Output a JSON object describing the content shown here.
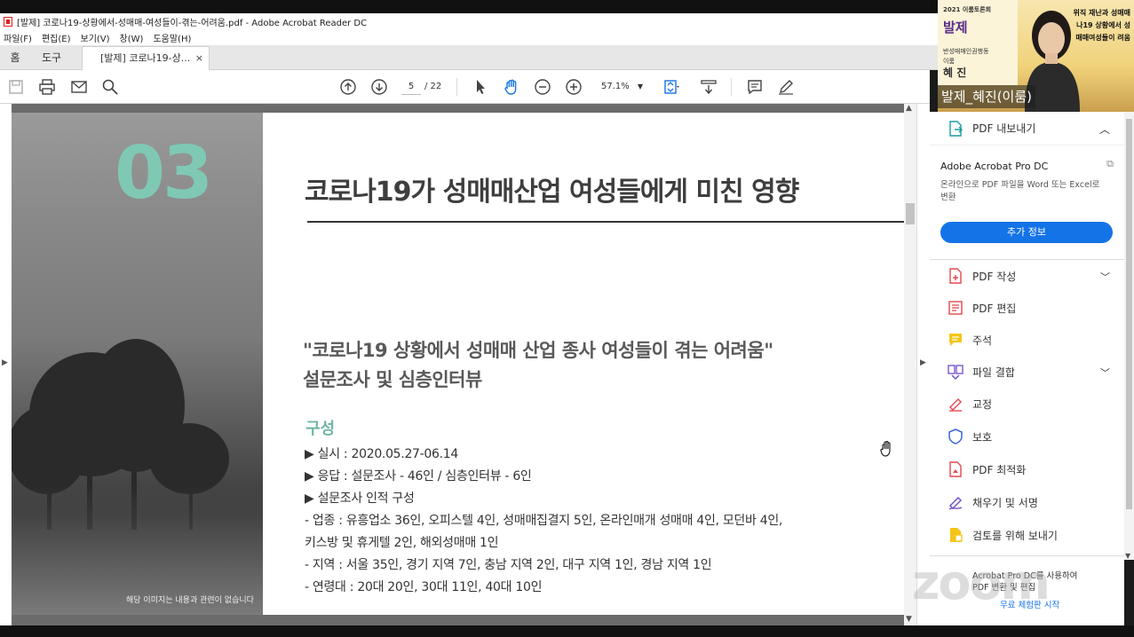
{
  "window": {
    "title": "[발제] 코로나19-상황에서-성매매-여성들이-겪는-어려움.pdf - Adobe Acrobat Reader DC"
  },
  "menu": [
    "파일(F)",
    "편집(E)",
    "보기(V)",
    "창(W)",
    "도움말(H)"
  ],
  "tabs": {
    "home": "홈",
    "tools": "도구",
    "document": "[발제] 코로나19-상...",
    "close": "×"
  },
  "toolbar": {
    "page_current": "5",
    "page_total": "/ 22",
    "zoom": "57.1%"
  },
  "slide": {
    "number": "03",
    "title": "코로나19가 성매매산업 여성들에게 미친 영향",
    "quote_line1": "\"코로나19 상황에서 성매매 산업 종사 여성들이 겪는 어려움\"",
    "quote_line2": "설문조사 및 심층인터뷰",
    "section_heading": "구성",
    "lines": [
      "▶ 실시 : 2020.05.27-06.14",
      "▶ 응답 : 설문조사 - 46인 / 심층인터뷰 - 6인",
      "▶ 설문조사 인적 구성",
      "- 업종 : 유흥업소 36인, 오피스텔 4인, 성매매집결지 5인, 온라인매개 성매매 4인, 모던바 4인,",
      "키스방 및 휴게텔 2인, 해외성매매 1인",
      "- 지역 : 서울 35인, 경기 지역 7인, 충남 지역 2인, 대구 지역 1인, 경남 지역 1인",
      "- 연령대 : 20대 20인, 30대 11인, 40대 10인"
    ],
    "photo_caption": "해당 이미지는 내용과 관련이 없습니다"
  },
  "right_panel": {
    "export_label": "PDF 내보내기",
    "promo_title": "Adobe Acrobat Pro DC",
    "promo_desc": "온라인으로 PDF 파일을 Word 또는 Excel로 변환",
    "more_button": "추가 정보",
    "tools": [
      {
        "label": "PDF 작성",
        "icon": "pdf-create-icon",
        "color": "#e34850",
        "chevron": true
      },
      {
        "label": "PDF 편집",
        "icon": "pdf-edit-icon",
        "color": "#e34850",
        "chevron": false
      },
      {
        "label": "주석",
        "icon": "comment-icon",
        "color": "#f5c518",
        "chevron": false
      },
      {
        "label": "파일 결합",
        "icon": "combine-files-icon",
        "color": "#6d4cc8",
        "chevron": true
      },
      {
        "label": "교정",
        "icon": "redact-icon",
        "color": "#e34850",
        "chevron": false
      },
      {
        "label": "보호",
        "icon": "protect-icon",
        "color": "#3b68d8",
        "chevron": false
      },
      {
        "label": "PDF 최적화",
        "icon": "optimize-pdf-icon",
        "color": "#e34850",
        "chevron": false
      },
      {
        "label": "채우기 및 서명",
        "icon": "fill-sign-icon",
        "color": "#6d4cc8",
        "chevron": false
      },
      {
        "label": "검토를 위해 보내기",
        "icon": "send-review-icon",
        "color": "#f5c518",
        "chevron": false
      }
    ],
    "bottom_line1": "Acrobat Pro DC를 사용하여",
    "bottom_line2": "PDF 변환 및 편집",
    "bottom_link": "무료 체험판 시작"
  },
  "video": {
    "badge": "2021 이룸토론회",
    "balje": "발제",
    "org": "반성매매인권행동",
    "role": "이룸",
    "name": "혜 진",
    "side_text": "위직 재난과 성매매 나19 상황에서 성매매여성들이 려움",
    "speaker_label": "발제_혜진(이룸)"
  },
  "watermark": "zoom",
  "colors": {
    "accent_teal": "#7fc8b4",
    "acrobat_blue": "#1473e6"
  }
}
